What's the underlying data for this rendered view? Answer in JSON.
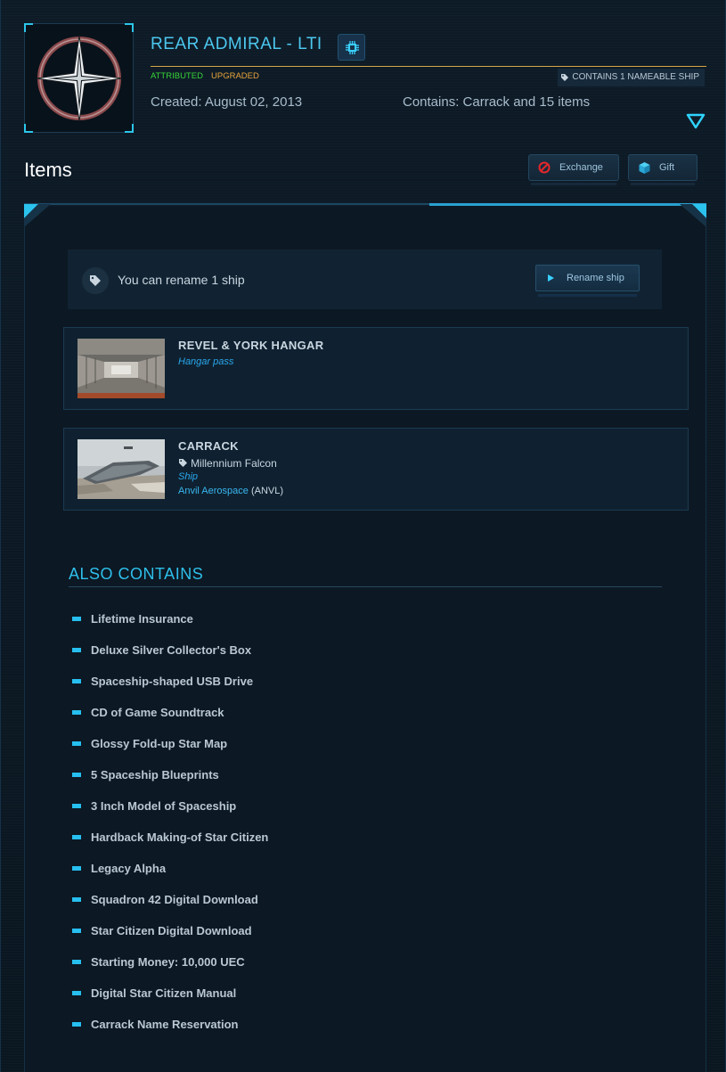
{
  "package": {
    "title": "REAR ADMIRAL - LTI",
    "status_attributed": "ATTRIBUTED",
    "status_upgraded": "UPGRADED",
    "contains_badge": "CONTAINS 1 NAMEABLE SHIP",
    "created": "Created: August 02, 2013",
    "contains": "Contains: Carrack and 15 items"
  },
  "items_section": {
    "heading": "Items",
    "exchange_label": "Exchange",
    "gift_label": "Gift"
  },
  "rename": {
    "message": "You can rename 1 ship",
    "button_label": "Rename ship"
  },
  "items": [
    {
      "name": "REVEL & YORK HANGAR",
      "type": "Hangar pass"
    },
    {
      "name": "CARRACK",
      "custom_name": "Millennium Falcon",
      "type": "Ship",
      "manufacturer": "Anvil Aerospace",
      "manufacturer_code": "(ANVL)"
    }
  ],
  "also_contains": {
    "heading": "ALSO CONTAINS",
    "items": [
      "Lifetime Insurance",
      "Deluxe Silver Collector's Box",
      "Spaceship-shaped USB Drive",
      "CD of Game Soundtrack",
      "Glossy Fold-up Star Map",
      "5 Spaceship Blueprints",
      "3 Inch Model of Spaceship",
      "Hardback Making-of Star Citizen",
      "Legacy Alpha",
      "Squadron 42 Digital Download",
      "Star Citizen Digital Download",
      "Starting Money: 10,000 UEC",
      "Digital Star Citizen Manual",
      "Carrack Name Reservation"
    ]
  },
  "colors": {
    "accent": "#2ebfeb",
    "attributed": "#37d437",
    "upgraded": "#e7a43a",
    "background": "#0b1722"
  },
  "icons": [
    "star-emblem-icon",
    "chip-icon",
    "tag-icon",
    "collapse-arrow-icon",
    "no-entry-icon",
    "gift-cube-icon",
    "play-icon"
  ]
}
